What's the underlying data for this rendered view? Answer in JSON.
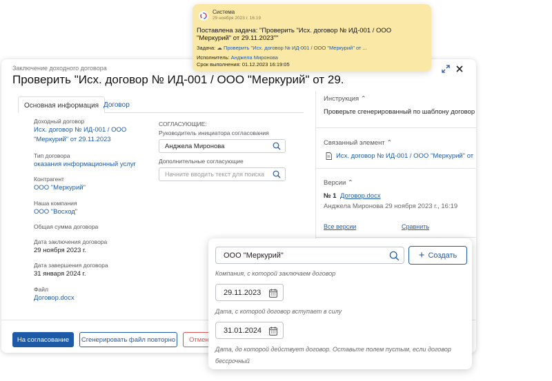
{
  "dialog": {
    "breadcrumb": "Заключение доходного договора",
    "title": "Проверить \"Исх. договор № ИД-001 / ООО \"Меркурий\" от 29.11.2...",
    "expand_icon": "expand-icon",
    "close_icon": "close-icon"
  },
  "tabs": [
    {
      "label": "Основная информация",
      "active": true
    },
    {
      "label": "Договор",
      "active": false
    }
  ],
  "fields": {
    "income_contract": {
      "label": "Доходный договор",
      "line1": "Исх. договор № ИД-001 / ООО",
      "line2": "\"Меркурий\" от 29.11.2023"
    },
    "contract_type": {
      "label": "Тип договора",
      "value": "оказания информационный услуг"
    },
    "counterparty": {
      "label": "Контрагент",
      "value": "ООО \"Меркурий\""
    },
    "our_company": {
      "label": "Наша компания",
      "value": "ООО \"Восход\""
    },
    "total_sum": {
      "label": "Общая сумма договора"
    },
    "conclusion_date": {
      "label": "Дата заключения договора",
      "value": "29 ноября 2023 г."
    },
    "end_date": {
      "label": "Дата завершения договора",
      "value": "31 января 2024 г."
    },
    "file": {
      "label": "Файл",
      "value": "Договор.docx"
    }
  },
  "approval": {
    "section": "СОГЛАСУЮЩИЕ:",
    "head_label": "Руководитель инициатора согласования",
    "head_value": "Анджела Миронова",
    "extra_label": "Дополнительные согласующие",
    "extra_placeholder": "Начните вводить текст для поиска"
  },
  "right": {
    "instruction_header": "Инструкция",
    "instruction_text": "Проверьте сгенерированный по шаблону договор",
    "linked_header": "Связанный элемент",
    "linked_item": "Исх. договор № ИД-001 / ООО \"Меркурий\" от 29.11.2023",
    "versions_header": "Версии",
    "version_no": "№ 1",
    "version_file": "Договор.docx",
    "version_meta": "Анджела Миронова 29 ноября 2023 г., 16:19",
    "all_versions": "Все версии",
    "compare": "Сравнить"
  },
  "footer": {
    "submit": "На согласование",
    "regenerate": "Сгенерировать файл повторно",
    "cancel": "Отмен"
  },
  "notification": {
    "sender": "Система",
    "time": "29 ноября 2023 г. 16:19",
    "title": "Поставлена задача: \"Проверить \"Исх. договор № ИД-001 / ООО \"Меркурий\" от 29.11.2023\"\"",
    "task_label": "Задача:",
    "task_value": "Проверить \"Исх. договор № ИД-001 / ООО \"Меркурий\" от ...",
    "executor_label": "Исполнитель:",
    "executor_value": "Анджела Миронова",
    "deadline_label": "Срок выполнения:",
    "deadline_value": "01.12.2023 16:19:05"
  },
  "overlay": {
    "company_value": "ООО \"Меркурий\"",
    "create_label": "Создать",
    "company_hint": "Компания, с которой заключаем договор",
    "start_date": "29.11.2023",
    "start_hint": "Дата, с которой договор вступает в силу",
    "end_date": "31.01.2024",
    "end_hint_1": "Дата, до которой действует договор. Оставьте полем пустым, если договор",
    "end_hint_2": "бессрочный"
  },
  "colors": {
    "accent": "#1f5aa6",
    "notification_bg": "#fae8a6",
    "danger": "#d9534f"
  }
}
